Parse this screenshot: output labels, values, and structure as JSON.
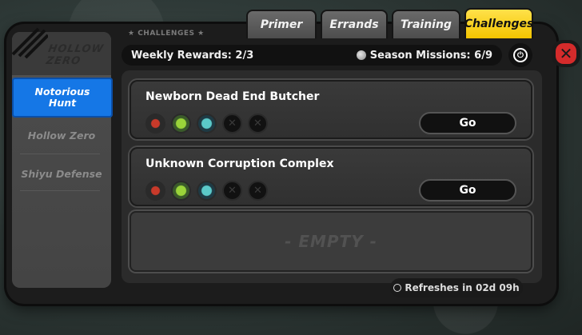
{
  "tabs": [
    {
      "label": "Primer"
    },
    {
      "label": "Errands"
    },
    {
      "label": "Training"
    },
    {
      "label": "Challenges",
      "active": true
    }
  ],
  "header": {
    "section_label": "CHALLENGES",
    "weekly_rewards": "Weekly Rewards: 2/3",
    "season_missions": "Season Missions: 6/9"
  },
  "sidebar": {
    "logo_text": "HOLLOW ZERO",
    "items": [
      {
        "label": "Notorious Hunt",
        "active": true
      },
      {
        "label": "Hollow Zero"
      },
      {
        "label": "Shiyu Defense"
      }
    ]
  },
  "cards": [
    {
      "title": "Newborn Dead End Butcher",
      "go_label": "Go"
    },
    {
      "title": "Unknown Corruption Complex",
      "go_label": "Go"
    }
  ],
  "empty_label": "- EMPTY -",
  "refresh_text": "Refreshes in 02d 09h",
  "colors": {
    "accent": "#f3c400",
    "active_side": "#1577e6",
    "close": "#d52b2b"
  }
}
